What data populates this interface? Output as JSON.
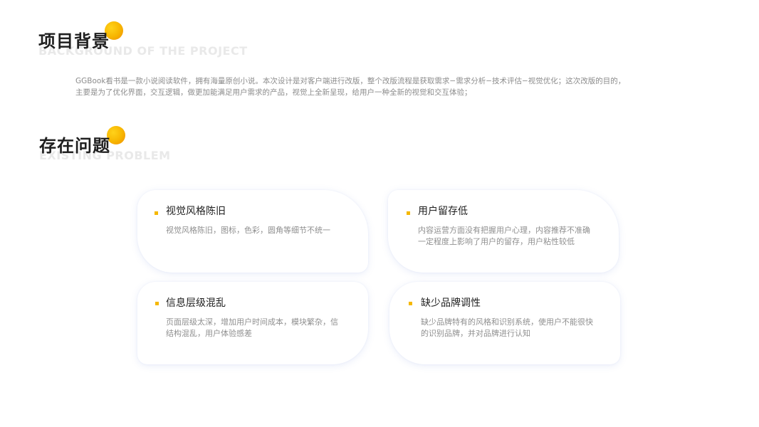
{
  "background_section": {
    "title": "项目背景",
    "subtitle": "BACKGROUND OF THE PROJECT",
    "intro_line1": "GGBook看书是一款小说阅读软件，拥有海量原创小说。本次设计是对客户端进行改版，整个改版流程是获取需求−需求分析−技术评估−视觉优化；这次改版的目的，",
    "intro_line2": "主要是为了优化界面，交互逻辑，做更加能满足用户需求的产品，视觉上全新呈现，给用户一种全新的视觉和交互体验；"
  },
  "problem_section": {
    "title": "存在问题",
    "subtitle": "EXISTING PROBLEM",
    "cards": [
      {
        "title": "视觉风格陈旧",
        "desc": "视觉风格陈旧，图标，色彩，圆角等细节不统一"
      },
      {
        "title": "用户留存低",
        "desc": "内容运营方面没有把握用户心理，内容推荐不准确一定程度上影响了用户的留存，用户粘性较低"
      },
      {
        "title": "信息层级混乱",
        "desc": "页面层级太深，增加用户时间成本，模块繁杂，信结构混乱，用户体验感差"
      },
      {
        "title": "缺少品牌调性",
        "desc": "缺少品牌特有的风格和识别系统，使用户不能很快的识别品牌，并对品牌进行认知"
      }
    ]
  },
  "colors": {
    "accent": "#f5b800",
    "title": "#1f1f1f",
    "body_text": "#8c8c8c"
  }
}
